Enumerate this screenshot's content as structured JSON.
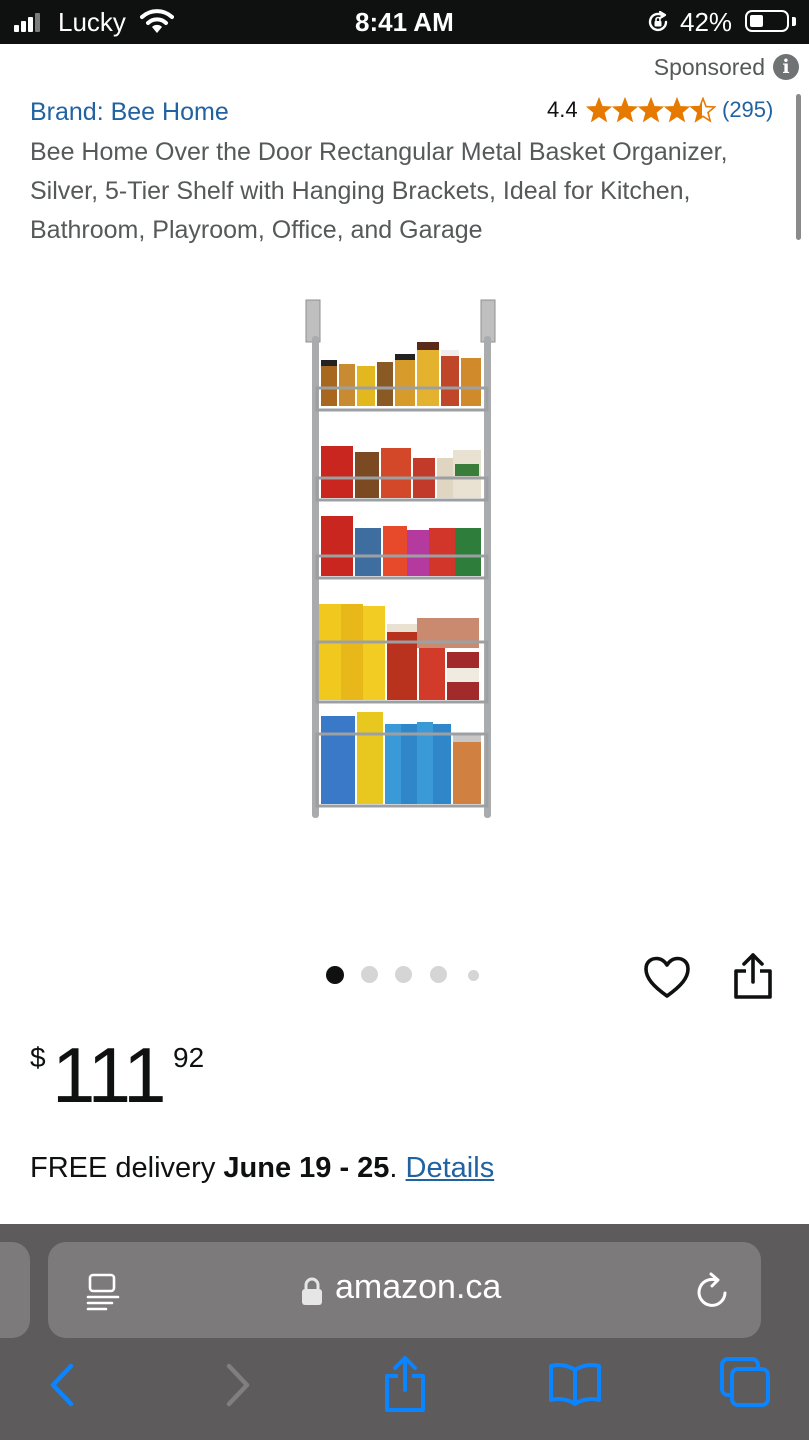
{
  "status_bar": {
    "carrier": "Lucky",
    "time": "8:41 AM",
    "battery": "42%"
  },
  "sponsored": "Sponsored",
  "brand": "Brand: Bee Home",
  "rating": {
    "value": "4.4",
    "count": "(295)",
    "stars": 4.4,
    "star_color": "#e67a00"
  },
  "title": "Bee Home Over the Door Rectangular Metal Basket Organizer, Silver, 5-Tier Shelf with Hanging Brackets, Ideal for Kitchen, Bathroom, Playroom, Office, and Garage",
  "carousel": {
    "total": 5,
    "active": 1
  },
  "price": {
    "currency": "$",
    "whole": "111",
    "fraction": "92"
  },
  "delivery": {
    "prefix": "FREE delivery ",
    "dates": "June 19 - 25",
    "separator": ". ",
    "link": "Details"
  },
  "browser": {
    "url": "amazon.ca"
  },
  "icons": {
    "signal": "signal-bars-icon",
    "wifi": "wifi-icon",
    "rotation_lock": "rotation-lock-icon",
    "battery": "battery-icon",
    "info": "info-icon",
    "heart": "heart-icon",
    "share": "share-icon",
    "reader": "reader-mode-icon",
    "lock": "lock-icon",
    "reload": "reload-icon",
    "back": "back-arrow-icon",
    "forward": "forward-arrow-icon",
    "bookmarks": "bookmarks-icon",
    "tabs": "tabs-icon"
  },
  "colors": {
    "link": "#2162a1",
    "toolbar_icon": "#0a84ff",
    "status_bg": "#0f1111",
    "chrome_bg": "#5d5b5c"
  }
}
